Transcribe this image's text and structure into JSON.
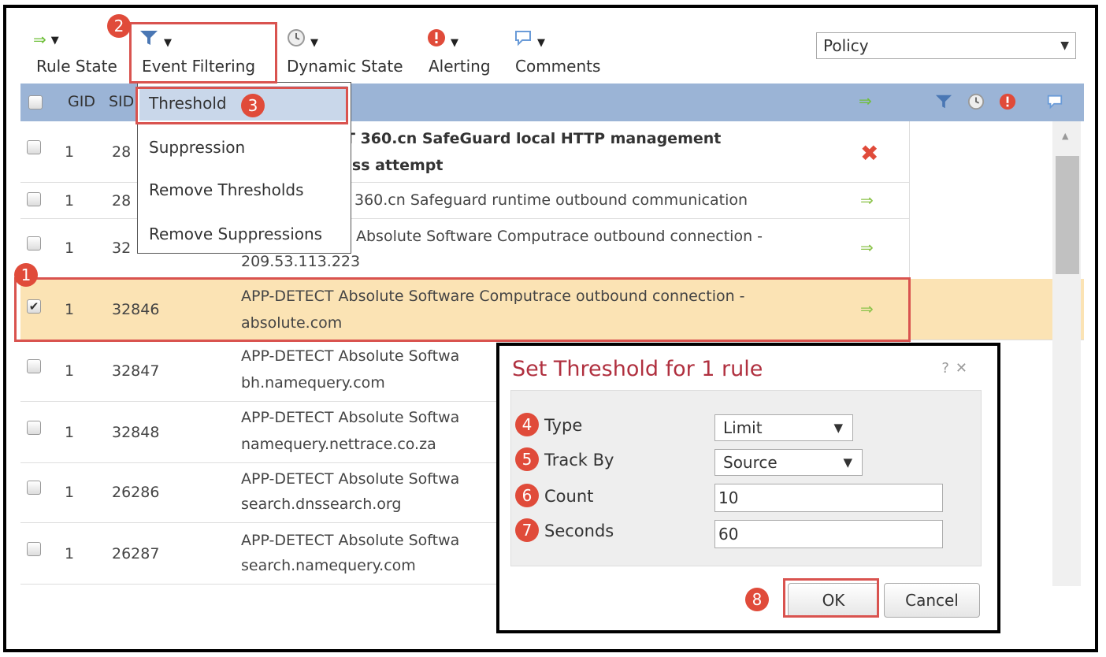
{
  "toolbar": {
    "rule_state": "Rule State",
    "event_filtering": "Event Filtering",
    "dynamic_state": "Dynamic State",
    "alerting": "Alerting",
    "comments": "Comments",
    "policy_value": "Policy"
  },
  "table": {
    "col_gid": "GID",
    "col_sid": "SID",
    "rows": [
      {
        "gid": "1",
        "sid": "28",
        "msg1": "T 360.cn SafeGuard local HTTP management",
        "msg2": "ess attempt",
        "state": "drop"
      },
      {
        "gid": "1",
        "sid": "28",
        "msg1": "360.cn Safeguard runtime outbound communication",
        "msg2": "",
        "state": "pass"
      },
      {
        "gid": "1",
        "sid": "32",
        "msg1": "Absolute Software Computrace outbound connection -",
        "msg2": "209.53.113.223",
        "state": "pass"
      },
      {
        "gid": "1",
        "sid": "32846",
        "msg1": "APP-DETECT Absolute Software Computrace outbound connection -",
        "msg2": "absolute.com",
        "state": "pass"
      },
      {
        "gid": "1",
        "sid": "32847",
        "msg1": "APP-DETECT Absolute Softwa",
        "msg2": "bh.namequery.com",
        "state": ""
      },
      {
        "gid": "1",
        "sid": "32848",
        "msg1": "APP-DETECT Absolute Softwa",
        "msg2": "namequery.nettrace.co.za",
        "state": ""
      },
      {
        "gid": "1",
        "sid": "26286",
        "msg1": "APP-DETECT Absolute Softwa",
        "msg2": "search.dnssearch.org",
        "state": ""
      },
      {
        "gid": "1",
        "sid": "26287",
        "msg1": "APP-DETECT Absolute Softwa",
        "msg2": "search.namequery.com",
        "state": ""
      }
    ]
  },
  "menu": {
    "threshold": "Threshold",
    "suppression": "Suppression",
    "remove_thresholds": "Remove Thresholds",
    "remove_suppressions": "Remove Suppressions"
  },
  "dialog": {
    "title": "Set Threshold for 1 rule",
    "help": "?",
    "close": "✕",
    "type_label": "Type",
    "type_value": "Limit",
    "track_label": "Track By",
    "track_value": "Source",
    "count_label": "Count",
    "count_value": "10",
    "seconds_label": "Seconds",
    "seconds_value": "60",
    "ok": "OK",
    "cancel": "Cancel"
  },
  "badges": [
    "1",
    "2",
    "3",
    "4",
    "5",
    "6",
    "7",
    "8"
  ],
  "colors": {
    "header": "#9bb4d6",
    "selected": "#fbe3b4",
    "callout": "#e04b3a",
    "title": "#b0303f",
    "pass": "#8bc34a",
    "drop": "#e04b3a"
  },
  "icons": [
    "pass-arrow-icon",
    "filter-icon",
    "clock-icon",
    "alert-icon",
    "comment-icon",
    "drop-x-icon"
  ]
}
